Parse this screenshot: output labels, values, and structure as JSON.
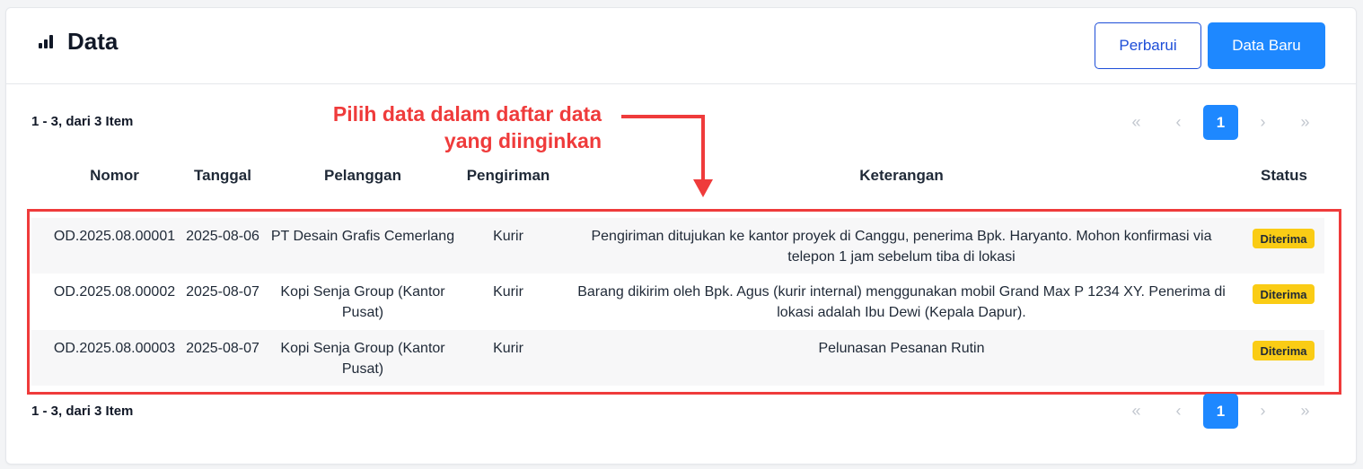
{
  "header": {
    "title": "Data",
    "title_icon": "bar-chart-icon",
    "refresh_label": "Perbarui",
    "new_label": "Data Baru"
  },
  "summary_text": "1 - 3, dari 3 Item",
  "pagination": {
    "first": "«",
    "prev": "‹",
    "current": "1",
    "next": "›",
    "last": "»"
  },
  "annotation": {
    "line1": "Pilih data dalam daftar data",
    "line2": "yang diinginkan",
    "color": "#ef3b3b"
  },
  "table": {
    "columns": [
      "Nomor",
      "Tanggal",
      "Pelanggan",
      "Pengiriman",
      "Keterangan",
      "Status"
    ],
    "rows": [
      {
        "nomor": "OD.2025.08.00001",
        "tanggal": "2025-08-06",
        "pelanggan": "PT Desain Grafis Cemerlang",
        "pengiriman": "Kurir",
        "keterangan": "Pengiriman ditujukan ke kantor proyek di Canggu, penerima Bpk. Haryanto. Mohon konfirmasi via telepon 1 jam sebelum tiba di lokasi",
        "status": "Diterima"
      },
      {
        "nomor": "OD.2025.08.00002",
        "tanggal": "2025-08-07",
        "pelanggan": "Kopi Senja Group (Kantor Pusat)",
        "pengiriman": "Kurir",
        "keterangan": "Barang dikirim oleh Bpk. Agus (kurir internal) menggunakan mobil Grand Max P 1234 XY. Penerima di lokasi adalah Ibu Dewi (Kepala Dapur).",
        "status": "Diterima"
      },
      {
        "nomor": "OD.2025.08.00003",
        "tanggal": "2025-08-07",
        "pelanggan": "Kopi Senja Group (Kantor Pusat)",
        "pengiriman": "Kurir",
        "keterangan": "Pelunasan Pesanan Rutin",
        "status": "Diterima"
      }
    ]
  },
  "colors": {
    "primary": "#1e88ff",
    "outline": "#1d4ed8",
    "badge": "#facc15"
  }
}
